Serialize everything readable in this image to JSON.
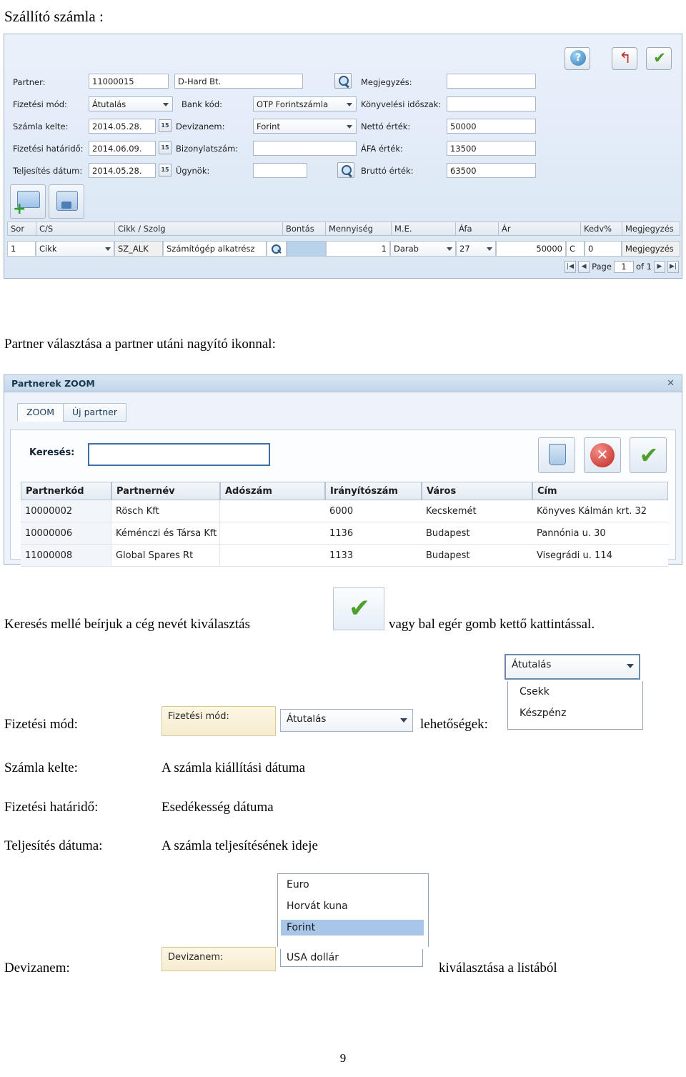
{
  "document": {
    "heading": "Szállító számla :",
    "caption_partner": "Partner választása a partner utáni nagyító ikonnal:",
    "caption_search_before": "Keresés mellé beírjuk a cég nevét  kiválasztás",
    "caption_search_after": "vagy bal egér gomb kettő kattintással.",
    "page_number": "9"
  },
  "invoice_form": {
    "labels": {
      "partner": "Partner:",
      "fizetesi_mod": "Fizetési mód:",
      "szamla_kelte": "Számla kelte:",
      "fizetesi_hatarido": "Fizetési határidő:",
      "teljesites_datum": "Teljesítés dátum:",
      "bank_kod": "Bank kód:",
      "devizanem": "Devizanem:",
      "bizonylatszam": "Bizonylatszám:",
      "ugynok": "Ügynök:",
      "megjegyzes": "Megjegyzés:",
      "konyvelesi_idoszak": "Könyvelési időszak:",
      "netto_ertek": "Nettó érték:",
      "afa_ertek": "ÁFA érték:",
      "brutto_ertek": "Bruttó érték:"
    },
    "values": {
      "partner_code": "11000015",
      "partner_name": "D-Hard Bt.",
      "fizetesi_mod": "Átutalás",
      "bank_kod": "OTP Forintszámla",
      "szamla_kelte": "2014.05.28.",
      "devizanem": "Forint",
      "netto_ertek": "50000",
      "fizetesi_hatarido": "2014.06.09.",
      "bizonylatszam": "",
      "afa_ertek": "13500",
      "teljesites_datum": "2014.05.28.",
      "ugynok": "",
      "brutto_ertek": "63500",
      "megjegyzes": "",
      "konyvelesi_idoszak": "",
      "cal_day": "15"
    },
    "toolbar": {
      "help": "?",
      "back": "↰",
      "ok": "✔"
    },
    "grid": {
      "headers": [
        "Sor",
        "C/S",
        "Cikk / Szolg",
        "Bontás",
        "Mennyiség",
        "M.E.",
        "Áfa",
        "Ár",
        "Kedv%",
        "Megjegyzés"
      ],
      "row": {
        "sor": "1",
        "cs": "Cikk",
        "cikk_code": "SZ_ALK",
        "cikk_name": "Számítógép alkatrész",
        "bontas": "",
        "mennyiseg": "1",
        "me": "Darab",
        "afa": "27",
        "ar": "50000",
        "kedv_flag": "C",
        "kedv": "0",
        "megjegyzes": "Megjegyzés"
      }
    },
    "pager": {
      "first": "|◀",
      "prev": "◀",
      "page_label": "Page",
      "page_value": "1",
      "of_label": "of 1",
      "next": "▶",
      "last": "▶|"
    }
  },
  "partner_zoom": {
    "title": "Partnerek ZOOM",
    "close": "✕",
    "tabs": [
      {
        "label": "ZOOM",
        "active": true
      },
      {
        "label": "Új partner",
        "active": false
      }
    ],
    "search_label": "Keresés:",
    "search_value": "",
    "buttons": {
      "trash": "trash",
      "cancel": "✕",
      "ok": "✔"
    },
    "table": {
      "headers": [
        "Partnerkód",
        "Partnernév",
        "Adószám",
        "Irányítószám",
        "Város",
        "Cím"
      ],
      "rows": [
        {
          "kod": "10000002",
          "nev": "Rösch Kft",
          "adoszam": "",
          "irsz": "6000",
          "varos": "Kecskemét",
          "cim": "Könyves Kálmán krt. 32"
        },
        {
          "kod": "10000006",
          "nev": "Kéménczi és Társa Kft",
          "adoszam": "",
          "irsz": "1136",
          "varos": "Budapest",
          "cim": "Pannónia u. 30"
        },
        {
          "kod": "11000008",
          "nev": "Global Spares Rt",
          "adoszam": "",
          "irsz": "1133",
          "varos": "Budapest",
          "cim": "Visegrádi u. 114"
        }
      ]
    }
  },
  "field_notes": {
    "fizetesi_mod": {
      "label": "Fizetési mód:",
      "shot_label": "Fizetési mód:",
      "shot_value": "Átutalás",
      "suffix": "lehetőségek:",
      "options_combo": "Átutalás",
      "options": [
        "Csekk",
        "Készpénz"
      ]
    },
    "szamla_kelte": {
      "label": "Számla kelte:",
      "desc": "A számla kiállítási dátuma"
    },
    "fizetesi_hatarido": {
      "label": "Fizetési határidő:",
      "desc": "Esedékesség dátuma"
    },
    "teljesites_datuma": {
      "label": "Teljesítés dátuma:",
      "desc": "A számla teljesítésének ideje"
    },
    "devizanem": {
      "label": "Devizanem:",
      "shot_label": "Devizanem:",
      "options": [
        "Euro",
        "Horvát kuna",
        "Forint",
        "USA dollár"
      ],
      "selected": "Forint",
      "suffix": "kiválasztása a listából"
    }
  }
}
